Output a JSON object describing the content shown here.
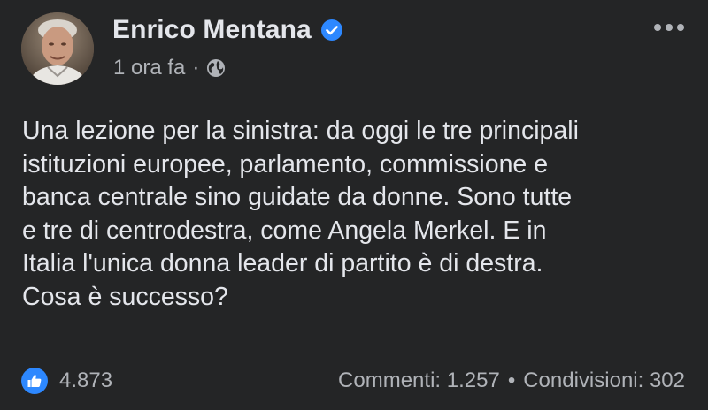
{
  "post": {
    "author": {
      "name": "Enrico Mentana",
      "verified_icon": "verified-badge-icon",
      "avatar_icon": "avatar"
    },
    "meta": {
      "time": "1 ora fa",
      "separator": "·",
      "audience_icon": "globe-icon"
    },
    "more_icon": "more-horizontal-icon",
    "text": "Una lezione per la sinistra: da oggi le tre principali\nistituzioni europee, parlamento, commissione e\nbanca centrale sino guidate da donne. Sono tutte\ne tre di centrodestra, come Angela Merkel. E in\nItalia l'unica donna leader di partito è di destra.\nCosa è successo?",
    "footer": {
      "reaction_icon": "like-icon",
      "reaction_count": "4.873",
      "comments": "Commenti: 1.257",
      "separator": "•",
      "shares": "Condivisioni: 302"
    }
  },
  "colors": {
    "background": "#242526",
    "primary_text": "#e4e6eb",
    "secondary_text": "#b0b3b8",
    "accent_blue": "#2d88ff"
  }
}
